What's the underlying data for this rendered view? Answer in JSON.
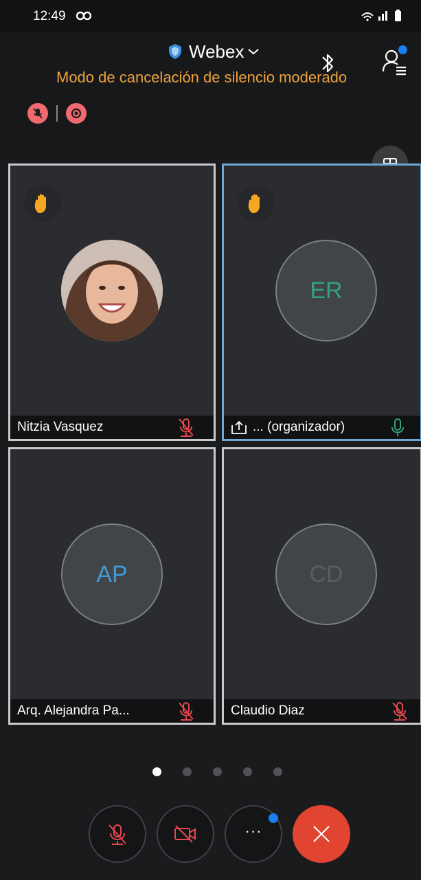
{
  "status_bar": {
    "time": "12:49"
  },
  "header": {
    "app_title": "Webex",
    "noise_mode": "Modo de cancelación de silencio moderado"
  },
  "participants": [
    {
      "name": "Nitzia Vasquez",
      "initials": "",
      "mic": "muted",
      "hand_raised": true,
      "avatar": "photo"
    },
    {
      "name": "... (organizador)",
      "initials": "ER",
      "initials_color": "#2fa37a",
      "mic": "active",
      "hand_raised": true,
      "sharing_icon": "share-upload-icon"
    },
    {
      "name": "Arq. Alejandra Pa...",
      "initials": "AP",
      "initials_color": "#3e9bd8",
      "mic": "muted",
      "hand_raised": false
    },
    {
      "name": "Claudio Diaz",
      "initials": "CD",
      "initials_color": "#5a5c60",
      "mic": "muted",
      "hand_raised": false
    }
  ],
  "pager": {
    "pages": 5,
    "current": 1
  },
  "colors": {
    "accent": "#1a7ff0",
    "warning": "#f0a23c",
    "muted": "#e8484f",
    "end_call": "#e14531",
    "active_border": "#6fa8d6"
  },
  "controls": {
    "more_label": "···"
  }
}
